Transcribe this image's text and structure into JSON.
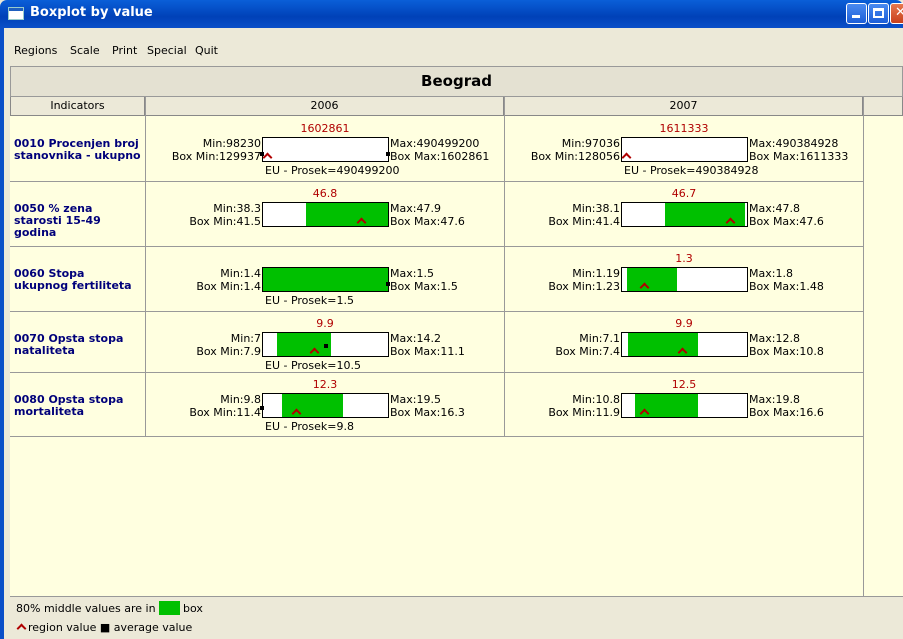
{
  "window": {
    "title": "Boxplot by value"
  },
  "menu": [
    "Regions",
    "Scale",
    "Print",
    "Special",
    "Quit"
  ],
  "region": "Beograd",
  "headers": {
    "indicators": "Indicators",
    "years": [
      "2006",
      "2007"
    ]
  },
  "rows": [
    {
      "name": "0010 Procenjen broj stanovnika - ukupno",
      "cells": [
        {
          "value": "1602861",
          "min": "Min:98230",
          "boxmin": "Box Min:129937",
          "max": "Max:490499200",
          "boxmax": "Box Max:1602861",
          "eu": "EU - Prosek=490499200",
          "green_from": 0,
          "green_to": 0,
          "region_pos": 0.0
        },
        {
          "value": "1611333",
          "min": "Min:97036",
          "boxmin": "Box Min:128056",
          "max": "Max:490384928",
          "boxmax": "Box Max:1611333",
          "eu": "EU - Prosek=490384928",
          "green_from": 0,
          "green_to": 0,
          "region_pos": 0.0
        }
      ]
    },
    {
      "name": "0050 % zena starosti 15-49 godina",
      "cells": [
        {
          "value": "46.8",
          "min": "Min:38.3",
          "boxmin": "Box Min:41.5",
          "max": "Max:47.9",
          "boxmax": "Box Max:47.6",
          "eu": "",
          "green_from": 0.34,
          "green_to": 1.0,
          "region_pos": 0.8
        },
        {
          "value": "46.7",
          "min": "Min:38.1",
          "boxmin": "Box Min:41.4",
          "max": "Max:47.8",
          "boxmax": "Box Max:47.6",
          "eu": "",
          "green_from": 0.34,
          "green_to": 0.98,
          "region_pos": 0.89
        }
      ]
    },
    {
      "name": "0060 Stopa ukupnog fertiliteta",
      "cells": [
        {
          "value": "",
          "min": "Min:1.4",
          "boxmin": "Box Min:1.4",
          "max": "Max:1.5",
          "boxmax": "Box Max:1.5",
          "eu": "EU - Prosek=1.5",
          "green_from": 0.0,
          "green_to": 1.0,
          "region_pos": -1
        },
        {
          "value": "1.3",
          "min": "Min:1.19",
          "boxmin": "Box Min:1.23",
          "max": "Max:1.8",
          "boxmax": "Box Max:1.48",
          "eu": "",
          "green_from": 0.04,
          "green_to": 0.44,
          "region_pos": 0.15
        }
      ]
    },
    {
      "name": "0070 Opsta stopa nataliteta",
      "cells": [
        {
          "value": "9.9",
          "min": "Min:7",
          "boxmin": "Box Min:7.9",
          "max": "Max:14.2",
          "boxmax": "Box Max:11.1",
          "eu": "EU - Prosek=10.5",
          "green_from": 0.11,
          "green_to": 0.54,
          "region_pos": 0.4
        },
        {
          "value": "9.9",
          "min": "Min:7.1",
          "boxmin": "Box Min:7.4",
          "max": "Max:12.8",
          "boxmax": "Box Max:10.8",
          "eu": "",
          "green_from": 0.05,
          "green_to": 0.61,
          "region_pos": 0.48
        }
      ]
    },
    {
      "name": "0080 Opsta stopa mortaliteta",
      "cells": [
        {
          "value": "12.3",
          "min": "Min:9.8",
          "boxmin": "Box Min:11.4",
          "max": "Max:19.5",
          "boxmax": "Box Max:16.3",
          "eu": "EU - Prosek=9.8",
          "green_from": 0.15,
          "green_to": 0.64,
          "region_pos": 0.25
        },
        {
          "value": "12.5",
          "min": "Min:10.8",
          "boxmin": "Box Min:11.9",
          "max": "Max:19.8",
          "boxmax": "Box Max:16.6",
          "eu": "",
          "green_from": 0.1,
          "green_to": 0.61,
          "region_pos": 0.15
        }
      ]
    }
  ],
  "legend": {
    "middle_text": "80% middle values are in",
    "box_word": "box",
    "keys_text": "region value  ■ average value"
  },
  "colors": {
    "box": "#00c000",
    "region_marker": "#b00000",
    "indicator_text": "#00007a",
    "cell_background": "#ffffe0"
  }
}
